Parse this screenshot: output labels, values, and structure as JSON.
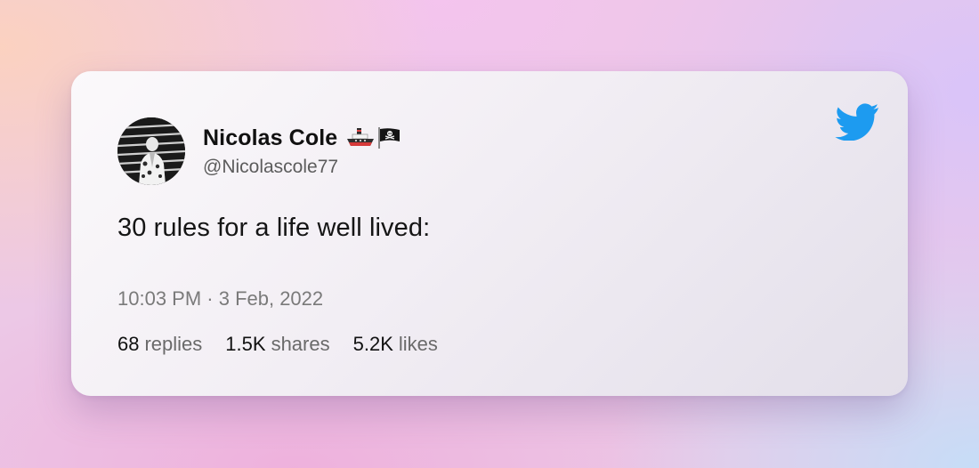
{
  "tweet": {
    "author_name": "Nicolas Cole",
    "author_handle": "@Nicolascole77",
    "text": "30 rules for a life well lived:",
    "timestamp": "10:03 PM · 3 Feb, 2022",
    "name_emojis": [
      "ship-emoji",
      "pirate-flag-emoji"
    ],
    "stats": {
      "replies": {
        "value": "68",
        "label": "replies"
      },
      "shares": {
        "value": "1.5K",
        "label": "shares"
      },
      "likes": {
        "value": "5.2K",
        "label": "likes"
      }
    }
  },
  "icons": {
    "brand": "twitter-bird-icon"
  },
  "colors": {
    "twitter_blue": "#1d9bf0",
    "name_text": "#111111",
    "secondary_text": "#6a6a6a"
  }
}
